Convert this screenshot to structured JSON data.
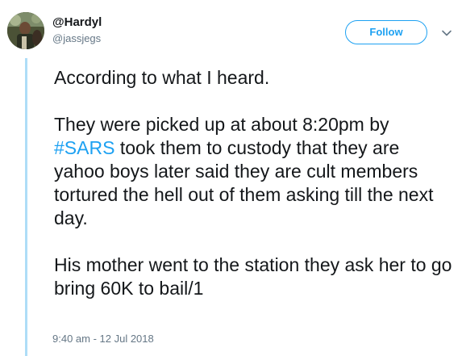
{
  "author": {
    "display_name": "@Hardyl",
    "handle": "@jassjegs"
  },
  "follow_button": {
    "label": "Follow"
  },
  "icons": {
    "more": "chevron-down-icon",
    "avatar": "avatar"
  },
  "tweet": {
    "line1": "According to what I heard.",
    "para2_before_hashtag": "They were picked up at about 8:20pm by ",
    "hashtag": "#SARS",
    "para2_after_hashtag": " took them to custody that they are yahoo boys later said they are cult members tortured the hell out of them asking till the next day.",
    "para3": "His mother went to the station they ask her to go bring 60K to bail/1"
  },
  "timestamp": "9:40 am - 12 Jul 2018",
  "colors": {
    "accent": "#1da1f2",
    "thread_line": "#aeddf7",
    "secondary_text": "#657786"
  }
}
